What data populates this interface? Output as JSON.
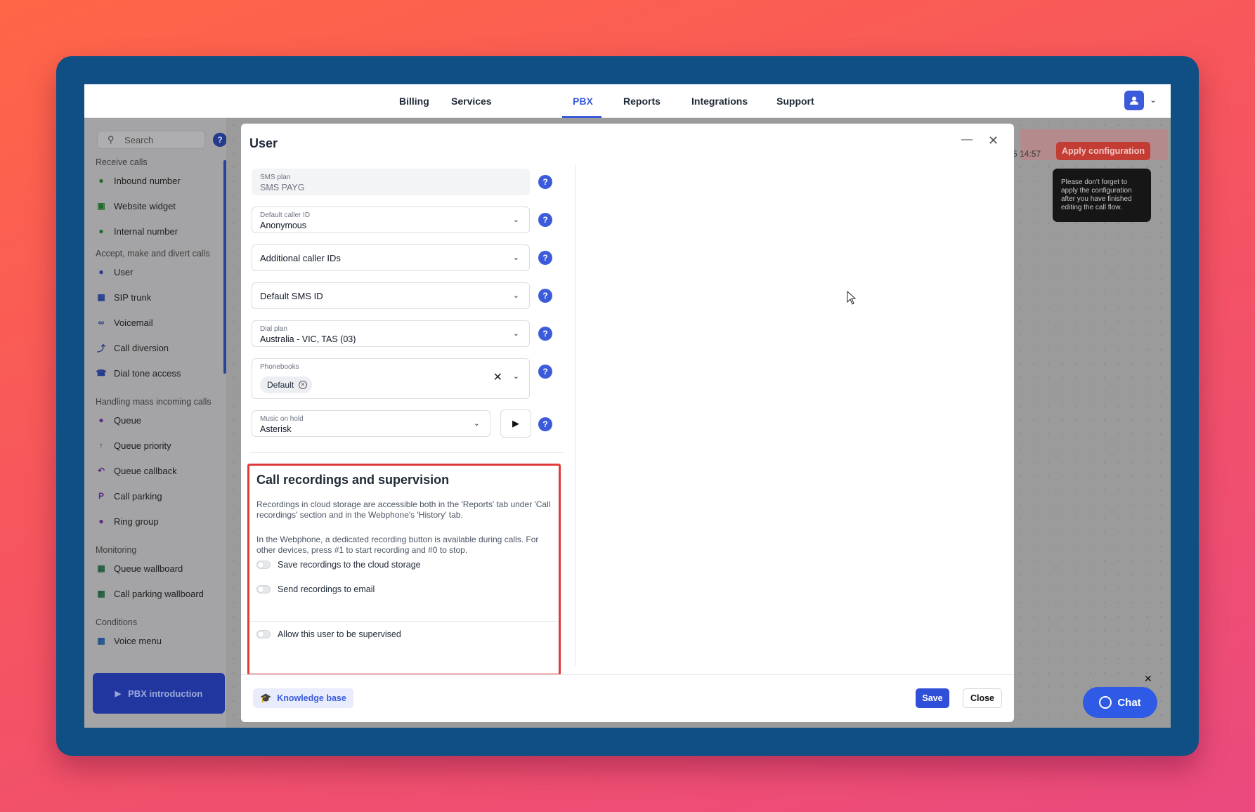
{
  "nav": {
    "tabs": [
      "Billing",
      "Services",
      "PBX",
      "Reports",
      "Integrations",
      "Support"
    ],
    "active_tab": "PBX"
  },
  "sidebar": {
    "search_placeholder": "Search",
    "help": "?",
    "sections": [
      {
        "title": "Receive calls",
        "items": [
          "Inbound number",
          "Website widget",
          "Internal number"
        ]
      },
      {
        "title": "Accept, make and divert calls",
        "items": [
          "User",
          "SIP trunk",
          "Voicemail",
          "Call diversion",
          "Dial tone access"
        ]
      },
      {
        "title": "Handling mass incoming calls",
        "items": [
          "Queue",
          "Queue priority",
          "Queue callback",
          "Call parking",
          "Ring group"
        ]
      },
      {
        "title": "Monitoring",
        "items": [
          "Queue wallboard",
          "Call parking wallboard"
        ]
      },
      {
        "title": "Conditions",
        "items": [
          "Voice menu"
        ]
      }
    ],
    "intro_button": "PBX introduction"
  },
  "background": {
    "apply_time": "5 14:57",
    "apply_button": "Apply configuration",
    "tooltip": "Please don't forget to apply the configuration after you have finished editing the call flow.",
    "chat_button": "Chat"
  },
  "modal": {
    "title": "User",
    "sms_plan": {
      "label": "SMS plan",
      "value": "SMS PAYG"
    },
    "default_caller_id": {
      "label": "Default caller ID",
      "value": "Anonymous"
    },
    "additional_caller_ids": {
      "label": "Additional caller IDs"
    },
    "default_sms_id": {
      "label": "Default SMS ID"
    },
    "dial_plan": {
      "label": "Dial plan",
      "value": "Australia - VIC, TAS (03)"
    },
    "phonebooks": {
      "label": "Phonebooks",
      "chip": "Default"
    },
    "music_on_hold": {
      "label": "Music on hold",
      "value": "Asterisk"
    },
    "recordings": {
      "title": "Call recordings and supervision",
      "para1": "Recordings in cloud storage are accessible both in the 'Reports' tab under 'Call recordings' section and in the Webphone's 'History' tab.",
      "para2": "In the Webphone, a dedicated recording button is available during calls. For other devices, press #1 to start recording and #0 to stop.",
      "toggle_cloud": "Save recordings to the cloud storage",
      "toggle_email": "Send recordings to email",
      "toggle_supervised": "Allow this user to be supervised",
      "toggle_cloud_on": false,
      "toggle_email_on": false,
      "toggle_supervised_on": false
    },
    "footer": {
      "knowledge_base": "Knowledge base",
      "save": "Save",
      "close": "Close"
    }
  },
  "colors": {
    "accent": "#3b5bdb",
    "highlight_border": "#e03b3b",
    "apply_button": "#c43d35",
    "chat": "#2f5ae6"
  }
}
